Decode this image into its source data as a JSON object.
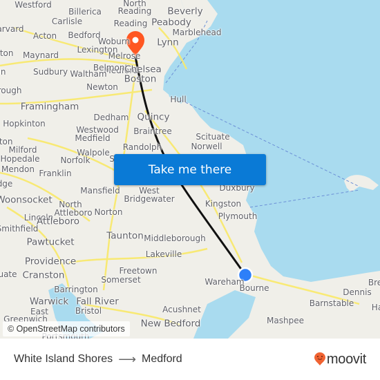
{
  "map": {
    "colors": {
      "water": "#a9dbef",
      "land": "#f0efe9",
      "road": "#f9e968",
      "route": "#111111",
      "origin": "#2d7ff9",
      "destination": "#ff5722"
    },
    "labels": [
      {
        "text": "Westford",
        "size": "n"
      },
      {
        "text": "Billerica",
        "size": "n"
      },
      {
        "text": "North",
        "size": "n"
      },
      {
        "text": "Reading",
        "size": "n"
      },
      {
        "text": "Beverly",
        "size": "big"
      },
      {
        "text": "arvard",
        "size": "n"
      },
      {
        "text": "Carlisle",
        "size": "n"
      },
      {
        "text": "Reading",
        "size": "n"
      },
      {
        "text": "Peabody",
        "size": "big"
      },
      {
        "text": "Acton",
        "size": "n"
      },
      {
        "text": "Bedford",
        "size": "n"
      },
      {
        "text": "Woburn",
        "size": "n"
      },
      {
        "text": "Marblehead",
        "size": "n"
      },
      {
        "text": "Lexington",
        "size": "n"
      },
      {
        "text": "Lynn",
        "size": "big"
      },
      {
        "text": "Maynard",
        "size": "n"
      },
      {
        "text": "Melrose",
        "size": "n"
      },
      {
        "text": "lton",
        "size": "n"
      },
      {
        "text": "Medford",
        "size": "n"
      },
      {
        "text": "Belmont",
        "size": "n"
      },
      {
        "text": "Chelsea",
        "size": "big"
      },
      {
        "text": "Sudbury",
        "size": "n"
      },
      {
        "text": "Waltham",
        "size": "n"
      },
      {
        "text": "Boston",
        "size": "big"
      },
      {
        "text": "in",
        "size": "n"
      },
      {
        "text": "Newton",
        "size": "n"
      },
      {
        "text": "rough",
        "size": "n"
      },
      {
        "text": "Hull",
        "size": "n"
      },
      {
        "text": "Framingham",
        "size": "big"
      },
      {
        "text": "Quincy",
        "size": "big"
      },
      {
        "text": "Dedham",
        "size": "n"
      },
      {
        "text": "Hopkinton",
        "size": "n"
      },
      {
        "text": "Westwood",
        "size": "n"
      },
      {
        "text": "Braintree",
        "size": "n"
      },
      {
        "text": "Scituate",
        "size": "n"
      },
      {
        "text": "Medfield",
        "size": "n"
      },
      {
        "text": "oton",
        "size": "n"
      },
      {
        "text": "Norwell",
        "size": "n"
      },
      {
        "text": "Milford",
        "size": "n"
      },
      {
        "text": "Walpole",
        "size": "n"
      },
      {
        "text": "Randolph",
        "size": "n"
      },
      {
        "text": "Hopedale",
        "size": "n"
      },
      {
        "text": "Norfolk",
        "size": "n"
      },
      {
        "text": "Mendon",
        "size": "n"
      },
      {
        "text": "Franklin",
        "size": "n"
      },
      {
        "text": "S",
        "size": "n"
      },
      {
        "text": "dge",
        "size": "n"
      },
      {
        "text": "West",
        "size": "n"
      },
      {
        "text": "Duxbury",
        "size": "n"
      },
      {
        "text": "Mansfield",
        "size": "n"
      },
      {
        "text": "Bridgewater",
        "size": "n"
      },
      {
        "text": "Woonsocket",
        "size": "big"
      },
      {
        "text": "North",
        "size": "n"
      },
      {
        "text": "Kingston",
        "size": "n"
      },
      {
        "text": "Attleboro",
        "size": "n"
      },
      {
        "text": "Norton",
        "size": "n"
      },
      {
        "text": "Lincoln",
        "size": "n"
      },
      {
        "text": "Attleboro",
        "size": "big"
      },
      {
        "text": "Plymouth",
        "size": "n"
      },
      {
        "text": "Smithfield",
        "size": "n"
      },
      {
        "text": "Taunton",
        "size": "big"
      },
      {
        "text": "Middleborough",
        "size": "n"
      },
      {
        "text": "Pawtucket",
        "size": "big"
      },
      {
        "text": "Lakeville",
        "size": "n"
      },
      {
        "text": "Providence",
        "size": "big"
      },
      {
        "text": "Freetown",
        "size": "n"
      },
      {
        "text": "uate",
        "size": "n"
      },
      {
        "text": "Cranston",
        "size": "big"
      },
      {
        "text": "Somerset",
        "size": "n"
      },
      {
        "text": "Wareham",
        "size": "n"
      },
      {
        "text": "Bourne",
        "size": "n"
      },
      {
        "text": "Bre",
        "size": "n"
      },
      {
        "text": "Barrington",
        "size": "n"
      },
      {
        "text": "Dennis",
        "size": "n"
      },
      {
        "text": "Warwick",
        "size": "big"
      },
      {
        "text": "Fall River",
        "size": "big"
      },
      {
        "text": "Barnstable",
        "size": "n"
      },
      {
        "text": "Ha",
        "size": "n"
      },
      {
        "text": "Acushnet",
        "size": "n"
      },
      {
        "text": "East",
        "size": "n"
      },
      {
        "text": "Bristol",
        "size": "n"
      },
      {
        "text": "Mashpee",
        "size": "n"
      },
      {
        "text": "Greenwich",
        "size": "n"
      },
      {
        "text": "New Bedford",
        "size": "big"
      },
      {
        "text": "Portsmouth",
        "size": "n"
      }
    ],
    "attribution": "© OpenStreetMap contributors",
    "cta_label": "Take me there"
  },
  "footer": {
    "origin": "White Island Shores",
    "arrow": "⟶",
    "destination": "Medford",
    "brand": "moovit",
    "brand_color": "#f06332"
  }
}
